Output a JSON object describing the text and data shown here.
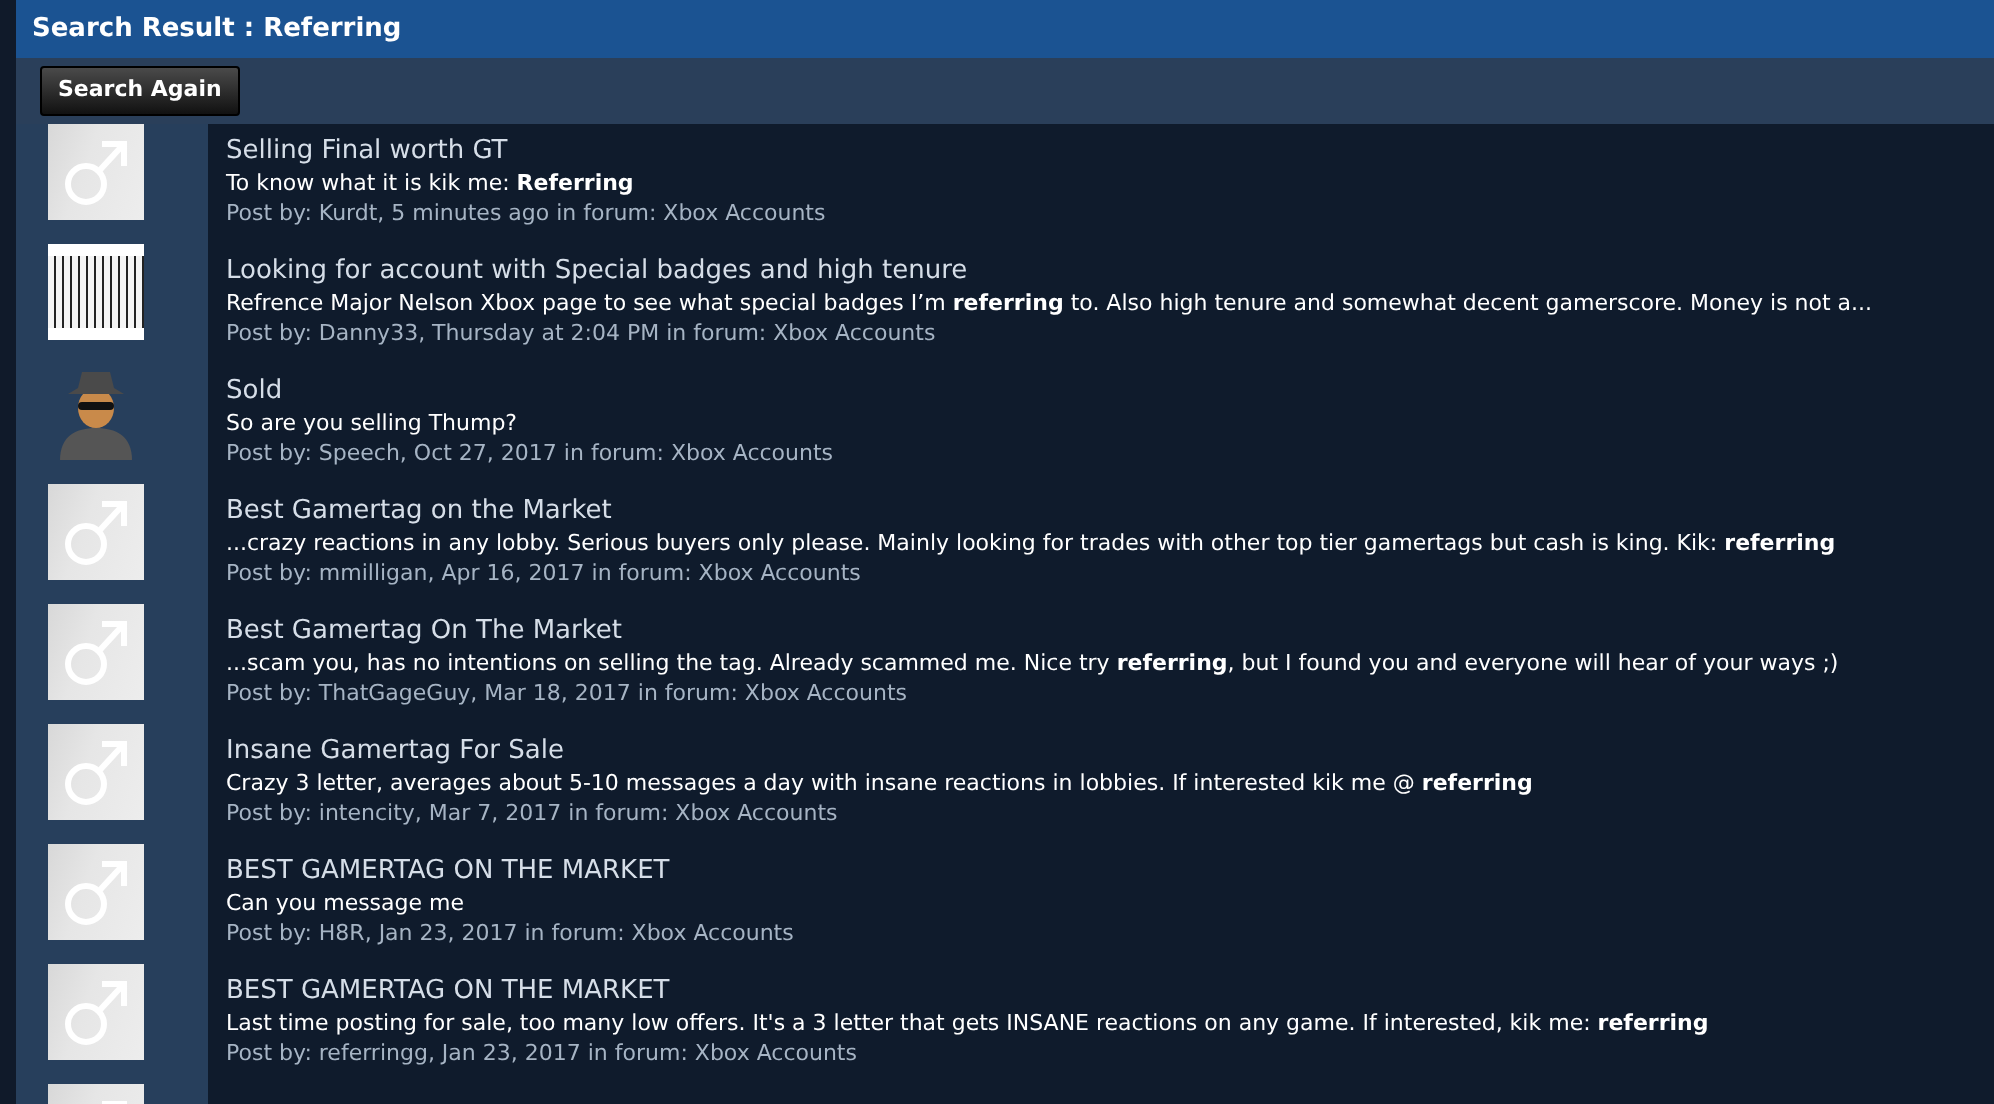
{
  "header": {
    "title": "Search Result : Referring"
  },
  "search_again_button": "Search Again",
  "results": [
    {
      "avatar": {
        "kind": "male-symbol"
      },
      "title": "Selling Final worth GT",
      "snippet": "To know what it is kik me: **Referring**",
      "meta": "Post by: Kurdt, 5 minutes ago in forum: Xbox Accounts"
    },
    {
      "avatar": {
        "kind": "logo"
      },
      "title": "Looking for account with Special badges and high tenure",
      "snippet": "Refrence Major Nelson Xbox page to see what special badges I’m **referring** to. Also high tenure and somewhat decent gamerscore. Money is not a...",
      "meta": "Post by: Danny33, Thursday at 2:04 PM in forum: Xbox Accounts"
    },
    {
      "avatar": {
        "kind": "silhouette"
      },
      "title": "Sold",
      "snippet": "So are you selling Thump?",
      "meta": "Post by: Speech, Oct 27, 2017 in forum: Xbox Accounts"
    },
    {
      "avatar": {
        "kind": "male-symbol"
      },
      "title": "Best Gamertag on the Market",
      "snippet": "...crazy reactions in any lobby. Serious buyers only please. Mainly looking for trades with other top tier gamertags but cash is king. Kik: **referring**",
      "meta": "Post by: mmilligan, Apr 16, 2017 in forum: Xbox Accounts"
    },
    {
      "avatar": {
        "kind": "male-symbol"
      },
      "title": "Best Gamertag On The Market",
      "snippet": "...scam you, has no intentions on selling the tag. Already scammed me. Nice try **referring**, but I found you and everyone will hear of your ways ;)",
      "meta": "Post by: ThatGageGuy, Mar 18, 2017 in forum: Xbox Accounts"
    },
    {
      "avatar": {
        "kind": "male-symbol"
      },
      "title": "Insane Gamertag For Sale",
      "snippet": "Crazy 3 letter, averages about 5-10 messages a day with insane reactions in lobbies. If interested kik me @ **referring**",
      "meta": "Post by: intencity, Mar 7, 2017 in forum: Xbox Accounts"
    },
    {
      "avatar": {
        "kind": "male-symbol"
      },
      "title": "BEST GAMERTAG ON THE MARKET",
      "snippet": "Can you message me",
      "meta": "Post by: H8R, Jan 23, 2017 in forum: Xbox Accounts"
    },
    {
      "avatar": {
        "kind": "male-symbol"
      },
      "title": "BEST GAMERTAG ON THE MARKET",
      "snippet": "Last time posting for sale, too many low offers. It's a 3 letter that gets INSANE reactions on any game. If interested, kik me: **referring**",
      "meta": "Post by: referringg, Jan 23, 2017 in forum: Xbox Accounts"
    },
    {
      "avatar": {
        "kind": "male-symbol"
      }
    }
  ]
}
